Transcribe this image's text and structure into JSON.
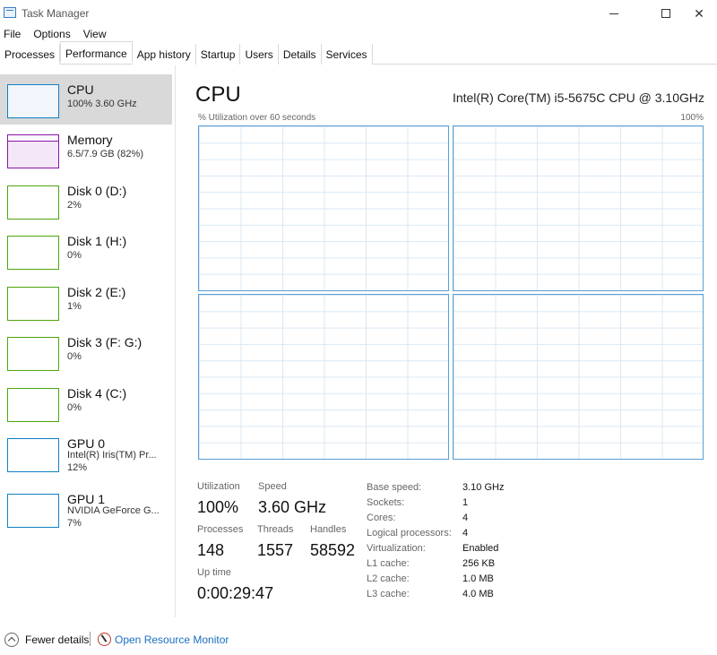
{
  "window": {
    "title": "Task Manager",
    "icons": {
      "app": "task-manager-icon",
      "minimize": "minimize-icon",
      "maximize": "maximize-icon",
      "close": "close-icon"
    },
    "close_glyph": "✕"
  },
  "menu": [
    "File",
    "Options",
    "View"
  ],
  "tabs": [
    {
      "label": "Processes"
    },
    {
      "label": "Performance",
      "active": true
    },
    {
      "label": "App history"
    },
    {
      "label": "Startup"
    },
    {
      "label": "Users"
    },
    {
      "label": "Details"
    },
    {
      "label": "Services"
    }
  ],
  "sidebar": {
    "items": [
      {
        "name": "CPU",
        "sub1": "100% 3.60 GHz",
        "sub2": "",
        "kind": "cpu",
        "selected": true
      },
      {
        "name": "Memory",
        "sub1": "6.5/7.9 GB (82%)",
        "sub2": "",
        "kind": "memory"
      },
      {
        "name": "Disk 0 (D:)",
        "sub1": "2%",
        "sub2": "",
        "kind": "disk"
      },
      {
        "name": "Disk 1 (H:)",
        "sub1": "0%",
        "sub2": "",
        "kind": "disk"
      },
      {
        "name": "Disk 2 (E:)",
        "sub1": "1%",
        "sub2": "",
        "kind": "disk"
      },
      {
        "name": "Disk 3 (F: G:)",
        "sub1": "0%",
        "sub2": "",
        "kind": "disk"
      },
      {
        "name": "Disk 4 (C:)",
        "sub1": "0%",
        "sub2": "",
        "kind": "disk"
      },
      {
        "name": "GPU 0",
        "sub1": "Intel(R) Iris(TM) Pr...",
        "sub2": "12%",
        "kind": "gpu"
      },
      {
        "name": "GPU 1",
        "sub1": "NVIDIA GeForce G...",
        "sub2": "7%",
        "kind": "gpu"
      }
    ],
    "colors": {
      "cpu": "#1180c7",
      "memory": "#8b12ae",
      "disk": "#4da60c",
      "gpu": "#1180c7"
    }
  },
  "main": {
    "title": "CPU",
    "model": "Intel(R) Core(TM) i5-5675C CPU @ 3.10GHz",
    "graph_label": "% Utilization over 60 seconds",
    "graph_max": "100%",
    "graph_color": "#5a9fd4",
    "stats": {
      "utilization": {
        "label": "Utilization",
        "value": "100%"
      },
      "speed": {
        "label": "Speed",
        "value": "3.60 GHz"
      },
      "processes": {
        "label": "Processes",
        "value": "148"
      },
      "threads": {
        "label": "Threads",
        "value": "1557"
      },
      "handles": {
        "label": "Handles",
        "value": "58592"
      },
      "uptime": {
        "label": "Up time",
        "value": "0:00:29:47"
      }
    },
    "info": [
      {
        "key": "Base speed:",
        "value": "3.10 GHz"
      },
      {
        "key": "Sockets:",
        "value": "1"
      },
      {
        "key": "Cores:",
        "value": "4"
      },
      {
        "key": "Logical processors:",
        "value": "4"
      },
      {
        "key": "Virtualization:",
        "value": "Enabled"
      },
      {
        "key": "L1 cache:",
        "value": "256 KB"
      },
      {
        "key": "L2 cache:",
        "value": "1.0 MB"
      },
      {
        "key": "L3 cache:",
        "value": "4.0 MB"
      }
    ]
  },
  "footer": {
    "fewer_details": "Fewer details",
    "open_resource_monitor": "Open Resource Monitor",
    "icons": {
      "fewer": "chevron-up-circle-icon",
      "resmon": "resource-monitor-icon"
    }
  }
}
